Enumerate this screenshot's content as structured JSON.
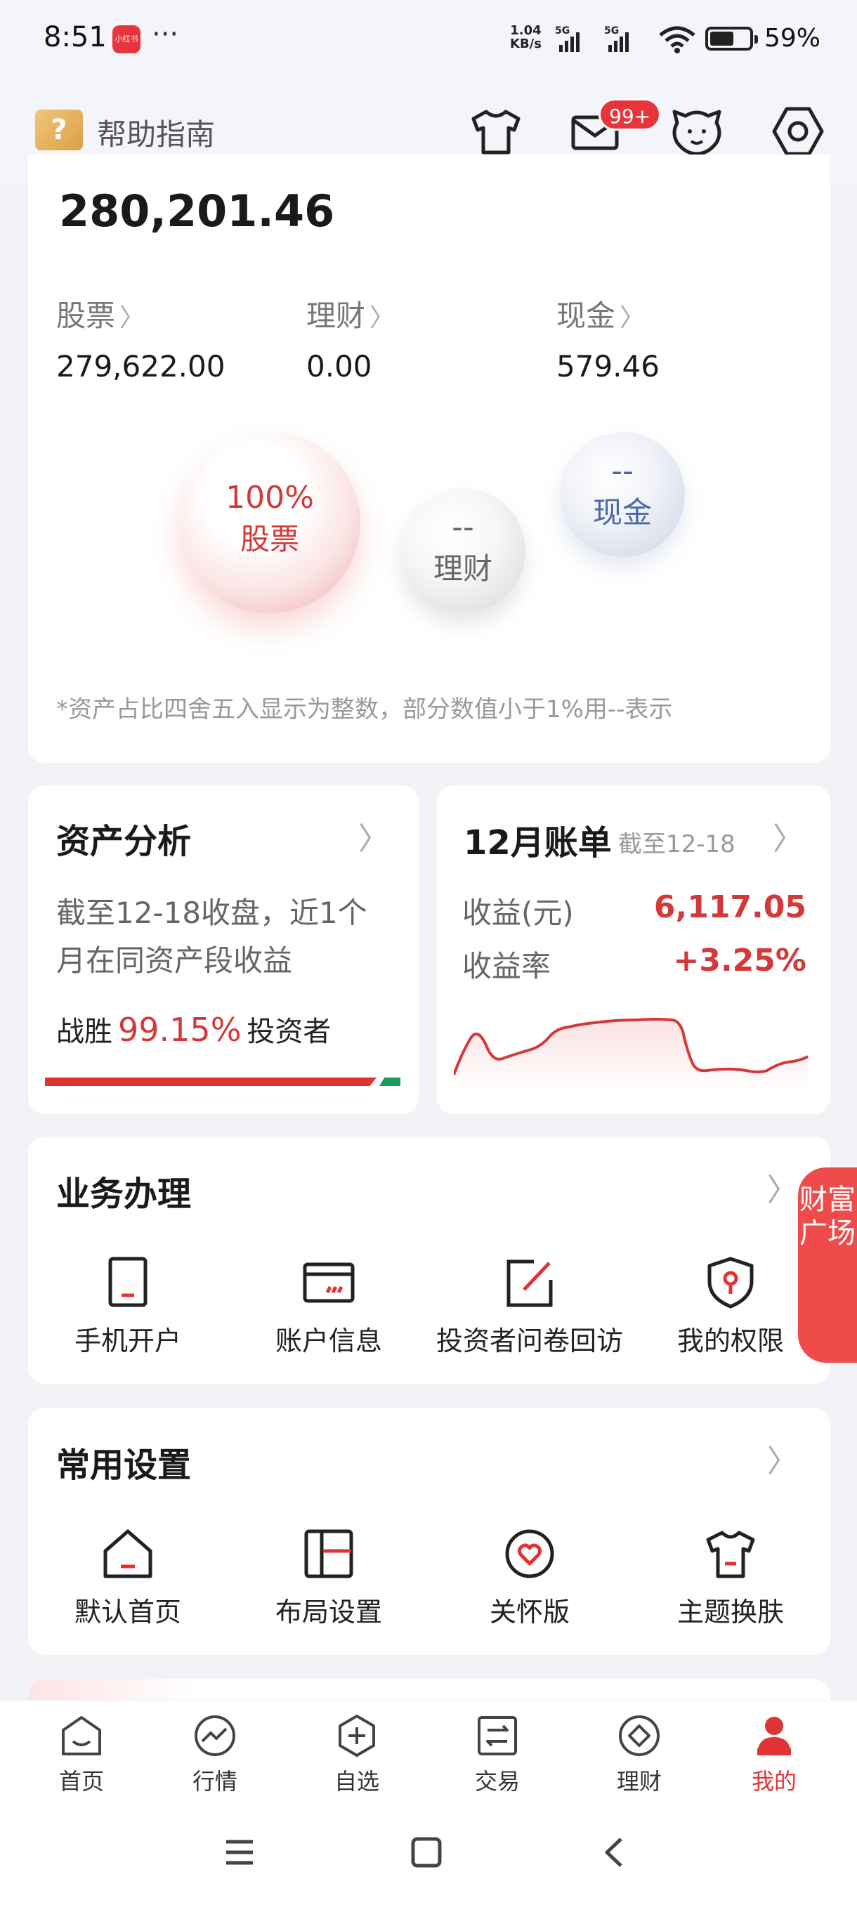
{
  "status": {
    "time": "8:51",
    "app_badge": "小红书",
    "more": "···",
    "net_speed_value": "1.04",
    "net_speed_unit": "KB/s",
    "sim1": "5G",
    "sim2": "5G",
    "battery": "59%"
  },
  "header": {
    "help_label": "帮助指南",
    "help_mark": "?",
    "mail_badge": "99+",
    "icons": [
      "tshirt-icon",
      "mail-icon",
      "mascot-icon",
      "settings-icon"
    ]
  },
  "assets": {
    "total": "280,201.46",
    "columns": [
      {
        "label": "股票",
        "value": "279,622.00"
      },
      {
        "label": "理财",
        "value": "0.00"
      },
      {
        "label": "现金",
        "value": "579.46"
      }
    ],
    "bubbles": {
      "stock": {
        "value": "100%",
        "label": "股票"
      },
      "finance": {
        "value": "--",
        "label": "理财"
      },
      "cash": {
        "value": "--",
        "label": "现金"
      }
    },
    "note": "*资产占比四舍五入显示为整数，部分数值小于1%用--表示"
  },
  "analysis": {
    "title": "资产分析",
    "desc": "截至12-18收盘，近1个月在同资产段收益",
    "beat_prefix": "战胜",
    "beat_pct": "99.15%",
    "beat_suffix": "投资者",
    "beat_fraction": 0.9915
  },
  "bill": {
    "title": "12月账单",
    "subtitle": "截至12-18",
    "income_label": "收益(元)",
    "income_value": "6,117.05",
    "rate_label": "收益率",
    "rate_value": "+3.25%"
  },
  "business": {
    "title": "业务办理",
    "items": [
      {
        "label": "手机开户",
        "icon": "phone-account-icon"
      },
      {
        "label": "账户信息",
        "icon": "card-icon"
      },
      {
        "label": "投资者问卷回访",
        "icon": "survey-icon"
      },
      {
        "label": "我的权限",
        "icon": "shield-key-icon"
      }
    ]
  },
  "settings": {
    "title": "常用设置",
    "items": [
      {
        "label": "默认首页",
        "icon": "home-icon"
      },
      {
        "label": "布局设置",
        "icon": "layout-icon"
      },
      {
        "label": "关怀版",
        "icon": "heart-icon"
      },
      {
        "label": "主题换肤",
        "icon": "tshirt-icon"
      }
    ]
  },
  "wealth_tab": "财富广场",
  "tabs": [
    {
      "label": "首页",
      "active": false
    },
    {
      "label": "行情",
      "active": false
    },
    {
      "label": "自选",
      "active": false
    },
    {
      "label": "交易",
      "active": false
    },
    {
      "label": "理财",
      "active": false
    },
    {
      "label": "我的",
      "active": true
    }
  ],
  "colors": {
    "accent_red": "#e03434",
    "green": "#1c9a5a",
    "cash_blue": "#4a69a8",
    "background": "#f2f3f7"
  }
}
